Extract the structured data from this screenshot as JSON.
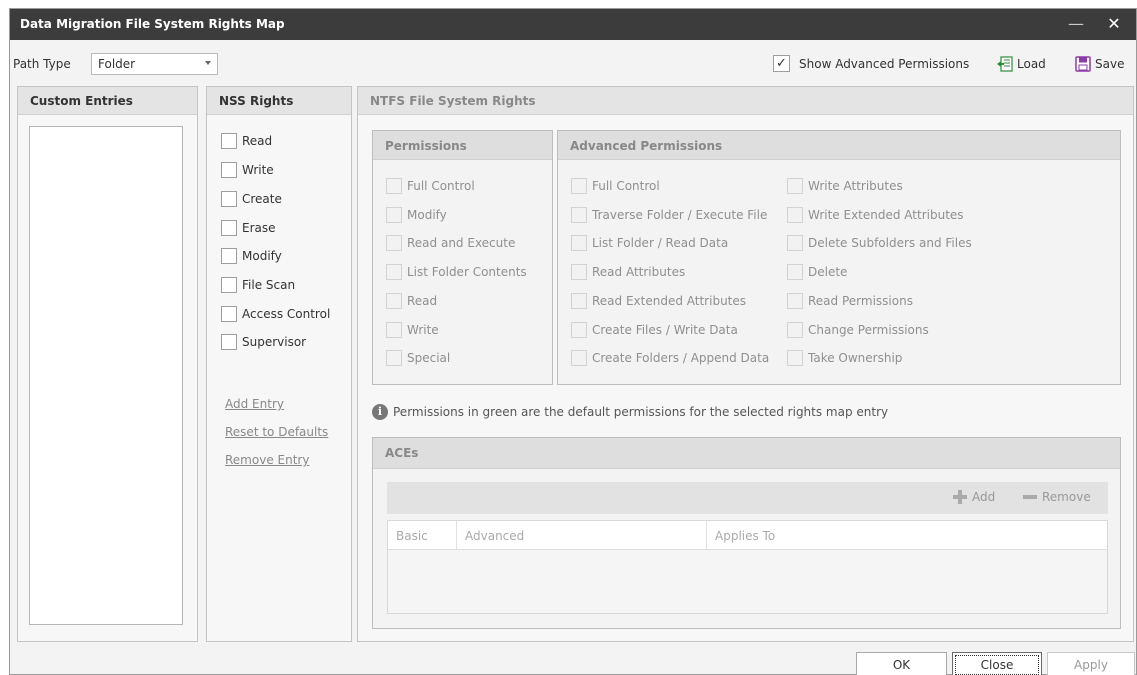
{
  "window": {
    "title": "Data Migration File System Rights Map"
  },
  "toolbar": {
    "path_type_label": "Path Type",
    "path_type_value": "Folder",
    "show_advanced_label": "Show Advanced Permissions",
    "show_advanced_checked": "✓",
    "load_label": "Load",
    "save_label": "Save"
  },
  "custom_entries": {
    "title": "Custom Entries"
  },
  "nss_rights": {
    "title": "NSS Rights",
    "items": [
      "Read",
      "Write",
      "Create",
      "Erase",
      "Modify",
      "File Scan",
      "Access Control",
      "Supervisor"
    ],
    "links": {
      "add": "Add Entry",
      "reset": "Reset to Defaults",
      "remove": "Remove Entry"
    }
  },
  "ntfs": {
    "title": "NTFS File System Rights",
    "permissions": {
      "title": "Permissions",
      "items": [
        "Full Control",
        "Modify",
        "Read and Execute",
        "List Folder Contents",
        "Read",
        "Write",
        "Special"
      ]
    },
    "advanced": {
      "title": "Advanced Permissions",
      "col1": [
        "Full Control",
        "Traverse Folder / Execute File",
        "List Folder / Read Data",
        "Read Attributes",
        "Read Extended Attributes",
        "Create Files / Write Data",
        "Create Folders / Append Data"
      ],
      "col2": [
        "Write Attributes",
        "Write Extended Attributes",
        "Delete Subfolders and Files",
        "Delete",
        "Read Permissions",
        "Change Permissions",
        "Take Ownership"
      ]
    },
    "info_text": "Permissions in green are the default permissions for the selected rights map entry",
    "aces": {
      "title": "ACEs",
      "add_label": "Add",
      "remove_label": "Remove",
      "columns": [
        "Basic",
        "Advanced",
        "Applies To"
      ]
    }
  },
  "footer": {
    "ok": "OK",
    "close": "Close",
    "apply": "Apply"
  },
  "colors": {
    "titlebar": "#3c3c3c",
    "panel_header": "#e4e4e4",
    "load_icon": "#2e8b3a",
    "save_icon": "#8e3aa8"
  }
}
